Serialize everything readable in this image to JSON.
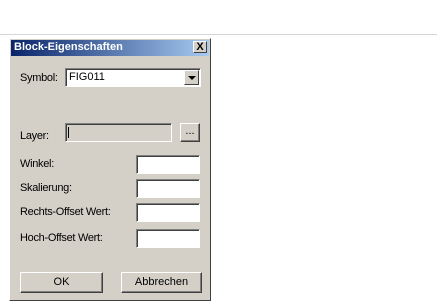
{
  "dialog": {
    "title": "Block-Eigenschaften",
    "close_label": "X",
    "symbol_label": "Symbol:",
    "symbol_value": "FIG011",
    "layer_label": "Layer:",
    "layer_value": "",
    "browse_label": "...",
    "fields": [
      {
        "label": "Winkel:",
        "value": ""
      },
      {
        "label": "Skalierung:",
        "value": ""
      },
      {
        "label": "Rechts-Offset Wert:",
        "value": ""
      },
      {
        "label": "Hoch-Offset Wert:",
        "value": ""
      }
    ],
    "ok_label": "OK",
    "cancel_label": "Abbrechen"
  },
  "colors": {
    "dialog_bg": "#d4d0c8",
    "title_start": "#0a246a",
    "title_end": "#a6caf0"
  },
  "icons": [
    "close-icon",
    "chevron-down-icon"
  ]
}
